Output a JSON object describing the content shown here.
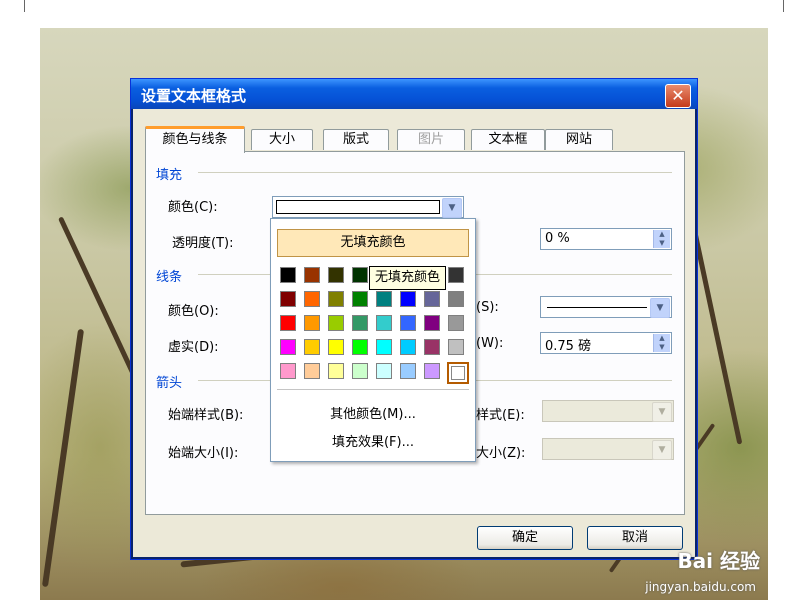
{
  "dialog": {
    "title": "设置文本框格式"
  },
  "tabs": [
    {
      "label": "颜色与线条",
      "state": "active"
    },
    {
      "label": "大小",
      "state": "normal"
    },
    {
      "label": "版式",
      "state": "normal"
    },
    {
      "label": "图片",
      "state": "disabled"
    },
    {
      "label": "文本框",
      "state": "normal"
    },
    {
      "label": "网站",
      "state": "normal"
    }
  ],
  "fill": {
    "heading": "填充",
    "color_label": "颜色(C):",
    "transparency_label": "透明度(T):",
    "transparency_value": "0 %"
  },
  "line": {
    "heading": "线条",
    "color_label": "颜色(O):",
    "dash_label": "虚实(D):",
    "style_label": "(S):",
    "weight_label": "(W):",
    "weight_value": "0.75 磅"
  },
  "arrows": {
    "heading": "箭头",
    "begin_style_label": "始端样式(B):",
    "begin_size_label": "始端大小(I):",
    "end_style_label": "样式(E):",
    "end_size_label": "大小(Z):"
  },
  "buttons": {
    "ok": "确定",
    "cancel": "取消"
  },
  "color_popup": {
    "no_fill_label": "无填充颜色",
    "more_colors": "其他颜色(M)...",
    "fill_effects": "填充效果(F)...",
    "tooltip": "无填充颜色",
    "swatches": [
      [
        "#000000",
        "#993300",
        "#333300",
        "#003300",
        "#003366",
        "#000080",
        "#333399",
        "#333333"
      ],
      [
        "#800000",
        "#ff6600",
        "#808000",
        "#008000",
        "#008080",
        "#0000ff",
        "#666699",
        "#808080"
      ],
      [
        "#ff0000",
        "#ff9900",
        "#99cc00",
        "#339966",
        "#33cccc",
        "#3366ff",
        "#800080",
        "#999999"
      ],
      [
        "#ff00ff",
        "#ffcc00",
        "#ffff00",
        "#00ff00",
        "#00ffff",
        "#00ccff",
        "#993366",
        "#c0c0c0"
      ],
      [
        "#ff99cc",
        "#ffcc99",
        "#ffff99",
        "#ccffcc",
        "#ccffff",
        "#99ccff",
        "#cc99ff",
        "#ffffff"
      ]
    ],
    "selected": [
      4,
      7
    ]
  },
  "watermark": {
    "brand": "Bai 经验",
    "url": "jingyan.baidu.com"
  }
}
